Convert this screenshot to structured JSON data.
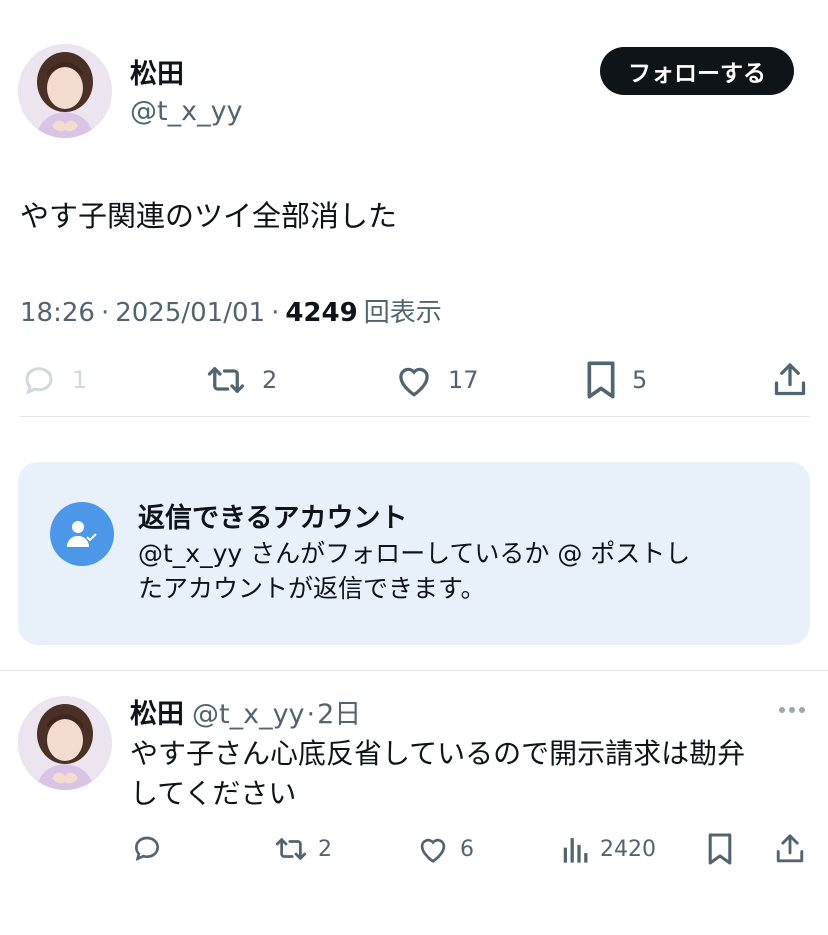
{
  "main_tweet": {
    "author_name": "松田",
    "author_handle": "@t_x_yy",
    "follow_label": "フォローする",
    "text": "やす子関連のツイ全部消した",
    "time": "18:26",
    "sep1": "·",
    "date": "2025/01/01",
    "sep2": "·",
    "views": "4249",
    "views_label": "回表示",
    "actions": {
      "reply_count": "1",
      "retweet_count": "2",
      "like_count": "17",
      "bookmark_count": "5"
    }
  },
  "reply_restriction": {
    "title": "返信できるアカウント",
    "description_line1": "@t_x_yy さんがフォローしているか @ ポストし",
    "description_line2": "たアカウントが返信できます。"
  },
  "reply_tweet": {
    "author_name": "松田",
    "author_handle": "@t_x_yy",
    "separator": "·",
    "time_ago": "2日",
    "text_line1": "やす子さん心底反省しているので開示請求は勘弁",
    "text_line2": "してください",
    "actions": {
      "retweet_count": "2",
      "like_count": "6",
      "view_count": "2420"
    }
  },
  "icons": {
    "reply": "reply-icon",
    "retweet": "retweet-icon",
    "like": "heart-icon",
    "bookmark": "bookmark-icon",
    "share": "share-icon",
    "views": "bar-chart-icon",
    "more": "more-icon",
    "restricted": "person-check-icon"
  },
  "colors": {
    "text": "#0f1419",
    "secondary": "#536471",
    "accent": "#4c97e8",
    "box_bg": "#e8f1f9"
  }
}
